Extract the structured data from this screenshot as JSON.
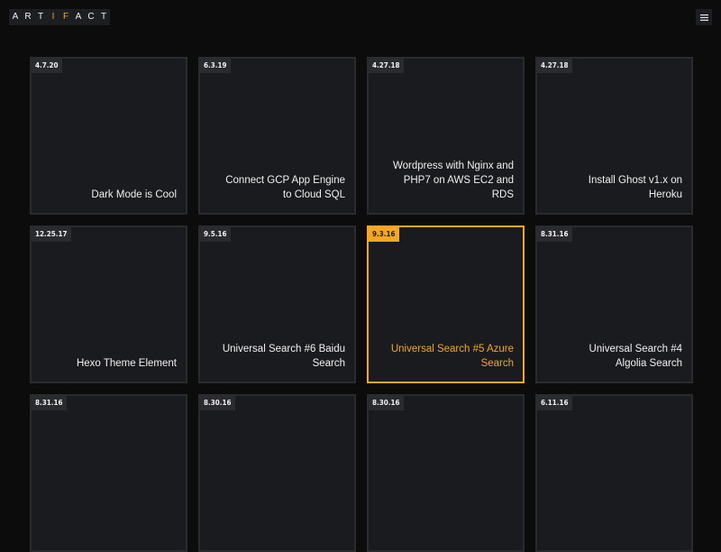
{
  "header": {
    "logo_letters": [
      "A",
      "R",
      "T",
      "I",
      "F",
      "A",
      "C",
      "T"
    ],
    "logo_accent_color": "#f5a623",
    "menu_icon": "hamburger-menu-icon"
  },
  "posts": [
    {
      "date": "4.7.20",
      "title": "Dark Mode is Cool"
    },
    {
      "date": "6.3.19",
      "title": "Connect GCP App Engine to Cloud SQL"
    },
    {
      "date": "4.27.18",
      "title": "Wordpress with Nginx and PHP7 on AWS EC2 and RDS"
    },
    {
      "date": "4.27.18",
      "title": "Install Ghost v1.x on Heroku"
    },
    {
      "date": "12.25.17",
      "title": "Hexo Theme Element"
    },
    {
      "date": "9.5.16",
      "title": "Universal Search #6 Baidu Search"
    },
    {
      "date": "9.3.16",
      "title": "Universal Search #5 Azure Search",
      "active": true
    },
    {
      "date": "8.31.16",
      "title": "Universal Search #4 Algolia Search"
    },
    {
      "date": "8.31.16",
      "title": ""
    },
    {
      "date": "8.30.16",
      "title": ""
    },
    {
      "date": "8.30.16",
      "title": ""
    },
    {
      "date": "6.11.16",
      "title": ""
    }
  ],
  "colors": {
    "background": "#0c0c0d",
    "card": "#1a1b1e",
    "accent": "#f5a623"
  }
}
